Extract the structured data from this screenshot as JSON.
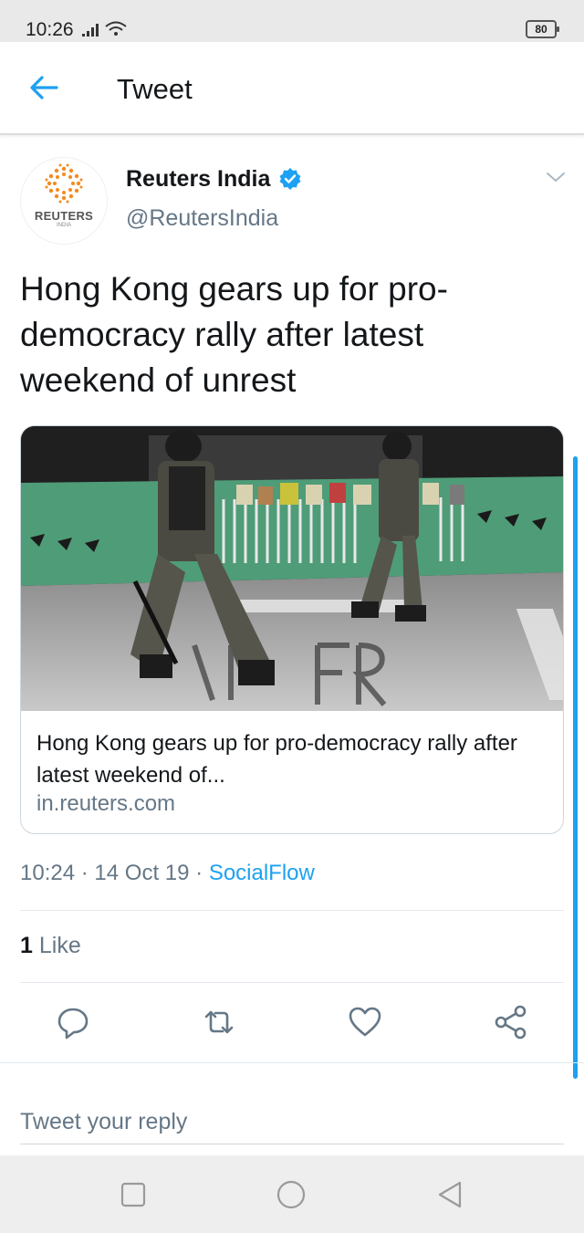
{
  "status_bar": {
    "time": "10:26",
    "battery": "80"
  },
  "header": {
    "title": "Tweet"
  },
  "author": {
    "name": "Reuters India",
    "handle": "@ReutersIndia",
    "logo_word": "REUTERS",
    "logo_sub": "INDIA"
  },
  "tweet": {
    "text": "Hong Kong gears up for pro-democracy rally after latest weekend of unrest",
    "time": "10:24",
    "date": "14 Oct 19",
    "source": "SocialFlow",
    "separator": "·"
  },
  "card": {
    "title": "Hong Kong gears up for pro-democracy rally after latest weekend of...",
    "domain": "in.reuters.com"
  },
  "likes": {
    "count": "1",
    "label": "Like"
  },
  "reply": {
    "placeholder": "Tweet your reply"
  },
  "colors": {
    "accent": "#1da1f2",
    "secondary_text": "#657786",
    "primary_text": "#14171a"
  }
}
